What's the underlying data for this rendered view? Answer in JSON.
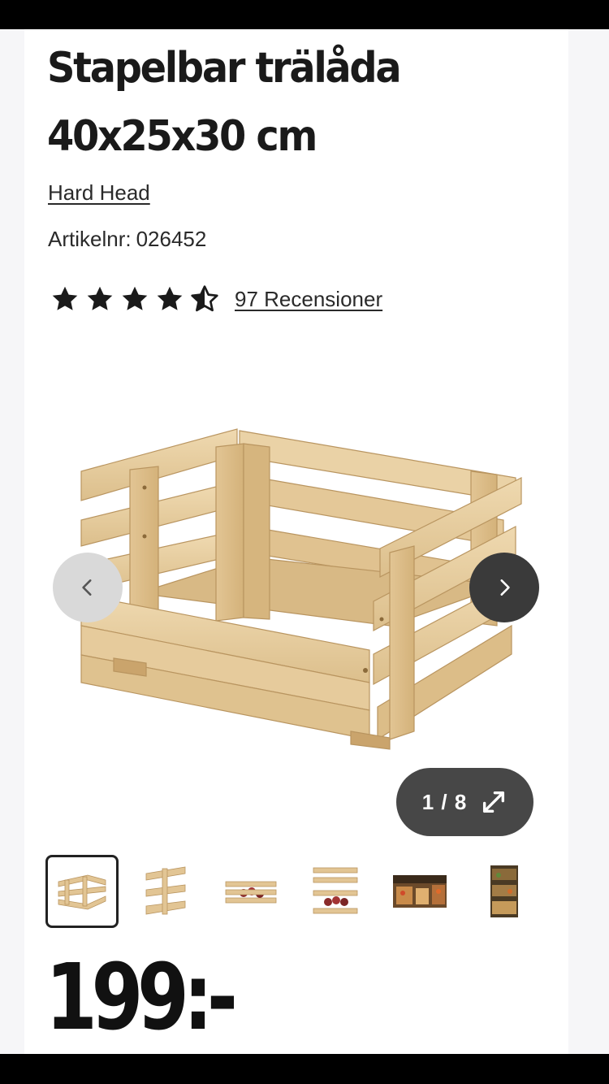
{
  "product": {
    "title_line1": "Stapelbar trälåda",
    "title_line2": "40x25x30 cm",
    "brand": "Hard Head",
    "sku_label": "Artikelnr:",
    "sku_value": "026452",
    "rating_value": 4.5,
    "rating_max": 5,
    "reviews_label": "97 Recensioner",
    "price": "199:-"
  },
  "gallery": {
    "counter": "1 / 8",
    "icons": {
      "prev": "chevron-left-icon",
      "next": "chevron-right-icon",
      "expand": "expand-icon"
    },
    "thumbnails": [
      {
        "name": "crate-front",
        "selected": true
      },
      {
        "name": "crate-side",
        "selected": false
      },
      {
        "name": "crate-with-apples",
        "selected": false
      },
      {
        "name": "crate-stacked",
        "selected": false
      },
      {
        "name": "crates-in-shop",
        "selected": false
      },
      {
        "name": "crate-shelf",
        "selected": false
      }
    ]
  },
  "colors": {
    "text": "#1a1a1a",
    "wood": "#e8cfa0",
    "nav_prev_bg": "#d9d9d9",
    "nav_next_bg": "#3a3a3a",
    "counter_bg": "#474747"
  }
}
